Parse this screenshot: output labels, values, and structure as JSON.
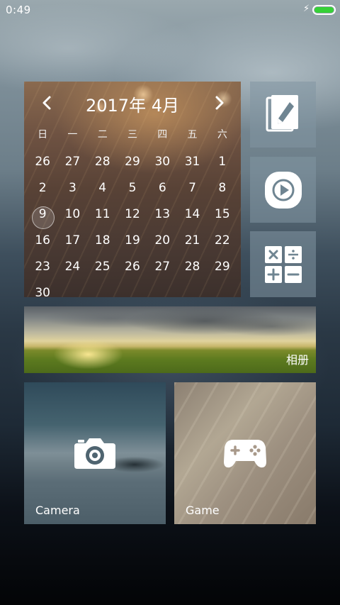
{
  "status_bar": {
    "time": "0:49",
    "charging_icon": "bolt-icon",
    "battery_color": "#36d137"
  },
  "calendar": {
    "year_month": "2017年 4月",
    "prev_icon": "chevron-left-icon",
    "next_icon": "chevron-right-icon",
    "weekdays": [
      "日",
      "一",
      "二",
      "三",
      "四",
      "五",
      "六"
    ],
    "days": [
      "26",
      "27",
      "28",
      "29",
      "30",
      "31",
      "1",
      "2",
      "3",
      "4",
      "5",
      "6",
      "7",
      "8",
      "9",
      "10",
      "11",
      "12",
      "13",
      "14",
      "15",
      "16",
      "17",
      "18",
      "19",
      "20",
      "21",
      "22",
      "23",
      "24",
      "25",
      "26",
      "27",
      "28",
      "29",
      "30"
    ],
    "today": "9"
  },
  "tiles": {
    "notes_icon": "notes-icon",
    "video_icon": "video-play-icon",
    "calculator_icon": "calculator-icon",
    "album_label": "相册",
    "camera_label": "Camera",
    "camera_icon": "camera-icon",
    "game_label": "Game",
    "game_icon": "gamepad-icon"
  }
}
